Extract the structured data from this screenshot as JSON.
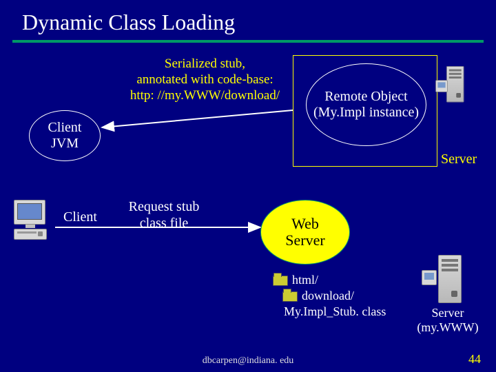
{
  "title": "Dynamic Class Loading",
  "annotation": {
    "line1": "Serialized stub,",
    "line2": "annotated with code-base:",
    "line3": "http: //my.WWW/download/"
  },
  "client_jvm": {
    "line1": "Client",
    "line2": "JVM"
  },
  "remote_obj": {
    "line1": "Remote Object",
    "line2": "(My.Impl instance)"
  },
  "server_box_label": "Server",
  "request": {
    "line1": "Request stub",
    "line2": "class file"
  },
  "client_label": "Client",
  "web_server": {
    "line1": "Web",
    "line2": "Server"
  },
  "folders": {
    "html": "html/",
    "download": "download/"
  },
  "stub_file": "My.Impl_Stub. class",
  "server_machine": {
    "line1": "Server",
    "line2": "(my.WWW)"
  },
  "footer": "dbcarpen@indiana. edu",
  "slide_no": "44"
}
